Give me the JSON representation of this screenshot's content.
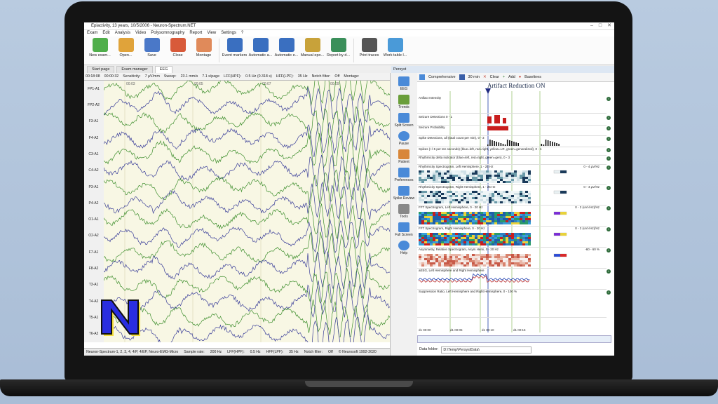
{
  "window": {
    "title": "Epiactivity, 13 years, 10/5/2006 - Neuron-Spectrum.NET",
    "controls": [
      "minimize",
      "maximize",
      "close"
    ]
  },
  "menu": [
    "Exam",
    "Edit",
    "Analysis",
    "Video",
    "Polysomnography",
    "Report",
    "View",
    "Settings",
    "?"
  ],
  "ribbon": [
    {
      "label": "New exam...",
      "icon": "new-exam-icon",
      "color": "#4fae4a"
    },
    {
      "label": "Open...",
      "icon": "open-icon",
      "color": "#e0a33a"
    },
    {
      "label": "Save",
      "icon": "save-icon",
      "color": "#4a78c8"
    },
    {
      "label": "Close",
      "icon": "close-exam-icon",
      "color": "#d85a3a"
    },
    {
      "label": "Montage",
      "icon": "montage-brain-icon",
      "color": "#e08a5a"
    },
    {
      "label": "Event markers",
      "icon": "event-markers-icon",
      "color": "#3a6fc0"
    },
    {
      "label": "Automatic a...",
      "icon": "automatic-analysis-icon",
      "color": "#3a6fc0"
    },
    {
      "label": "Automatic e...",
      "icon": "automatic-events-icon",
      "color": "#3a6fc0"
    },
    {
      "label": "Manual epo...",
      "icon": "manual-epochs-icon",
      "color": "#c8a23a"
    },
    {
      "label": "Report by d...",
      "icon": "report-icon",
      "color": "#3a8f5a"
    },
    {
      "label": "Print traces",
      "icon": "printer-icon",
      "color": "#555555"
    },
    {
      "label": "Work table l...",
      "icon": "work-table-icon",
      "color": "#4a9ad8"
    }
  ],
  "tabs": [
    "Start page",
    "Exam manager",
    "EEG"
  ],
  "eeg_toolbar": [
    "00:18:08",
    "00:00:32",
    "Sensitivity:",
    "7 µV/mm",
    "Sweep:",
    "23.1 mm/s",
    "7.1 s/page",
    "LFF(HPF):",
    "0.5 Hz (0.318 s)",
    "HFF(LPF):",
    "35 Hz",
    "Notch filter:",
    "Off",
    "Montage:"
  ],
  "channels": [
    "FP1-A1",
    "FP2-A2",
    "F3-A1",
    "F4-A2",
    "C3-A1",
    "C4-A2",
    "P3-A1",
    "P4-A2",
    "O1-A1",
    "O2-A2",
    "F7-A1",
    "F8-A2",
    "T3-A1",
    "T4-A2",
    "T5-A1",
    "T6-A2"
  ],
  "time_marks": [
    "00:03",
    "00:05",
    "00:07",
    "00:09"
  ],
  "status_bar": [
    "Neuron-Spectrum-1, 2, 3, 4, 4/P, 4/EP, Neuro-EMG-Micro",
    "Sample rate:",
    "200 Hz",
    "LFF(HPF):",
    "0.5 Hz",
    "HFF(LPF):",
    "35 Hz",
    "Notch filter:",
    "Off",
    "© Neurosoft 1992-2020"
  ],
  "persyst": {
    "panel_title": "Persyst",
    "menu": [
      {
        "label": "EEG",
        "icon": "eeg-icon"
      },
      {
        "label": "Trends",
        "icon": "trends-icon"
      },
      {
        "label": "Split Screen",
        "icon": "split-screen-icon"
      },
      {
        "label": "Pause",
        "icon": "pause-icon"
      },
      {
        "label": "Patient",
        "icon": "patient-icon"
      },
      {
        "label": "Preferences",
        "icon": "preferences-icon"
      },
      {
        "label": "Spike Review",
        "icon": "spike-review-icon"
      },
      {
        "label": "Tools",
        "icon": "tools-icon"
      },
      {
        "label": "Full Screen",
        "icon": "full-screen-icon"
      },
      {
        "label": "Help",
        "icon": "help-icon"
      }
    ],
    "toolbar": {
      "mode": "Comprehensive",
      "duration": "30 min",
      "clear": "Clear",
      "add": "Add",
      "baselines": "Baselines"
    },
    "artifact_reduction": "Artifact Reduction ON",
    "trends": [
      {
        "label": "Artifact Intensity"
      },
      {
        "label": "Seizure Detections 0 - 1"
      },
      {
        "label": "Seizure Probability"
      },
      {
        "label": "Spike Detections, all (total count per min), 0 - 3"
      },
      {
        "label": "Spikes (+/-5 per ten seconds) (blue=left, red=right, yellow=LR, green=generalized), 0 - 1"
      },
      {
        "label": "Rhythmicity delta indicator (blue=left, red=right, green=gen), 0 - 3"
      },
      {
        "label": "Rhythmicity Spectrogram, Left Hemisphere, 1 - 25 Hz",
        "scale": "0 - 4 µV/Hz"
      },
      {
        "label": "Rhythmicity Spectrogram, Right Hemisphere, 1 - 25 Hz",
        "scale": "0 - 4 µV/Hz"
      },
      {
        "label": "FFT Spectrogram, Left Hemisphere, 0 - 20 Hz",
        "scale": "0 - 2 (uV/√Hz)/Hz"
      },
      {
        "label": "FFT Spectrogram, Right Hemisphere, 0 - 20 Hz",
        "scale": "0 - 2 (uV/√Hz)/Hz"
      },
      {
        "label": "Asymmetry, Relative Spectrogram, Asym Hemi, 0 - 20 Hz",
        "scale": "-60 - 60 %"
      },
      {
        "label": "aEEG, Left Hemisphere and Right Hemisphere"
      },
      {
        "label": "Suppression Ratio, Left Hemisphere and Right Hemisphere, 0 - 100 %"
      }
    ],
    "timeline": [
      "d1 00:00",
      "d1 00:05",
      "d1 00:10",
      "d1 00:15"
    ],
    "data_folder_label": "Data folder:",
    "data_folder_value": "D:\\Temp\\PersystData\\"
  },
  "logo_letter": "N",
  "colors": {
    "trace_green": "#3f8f2e",
    "trace_blue": "#3b3f9a",
    "eeg_bg": "#f8f7e4",
    "logo_blue": "#2a2ee0",
    "logo_yellow": "#f2dd3c"
  }
}
